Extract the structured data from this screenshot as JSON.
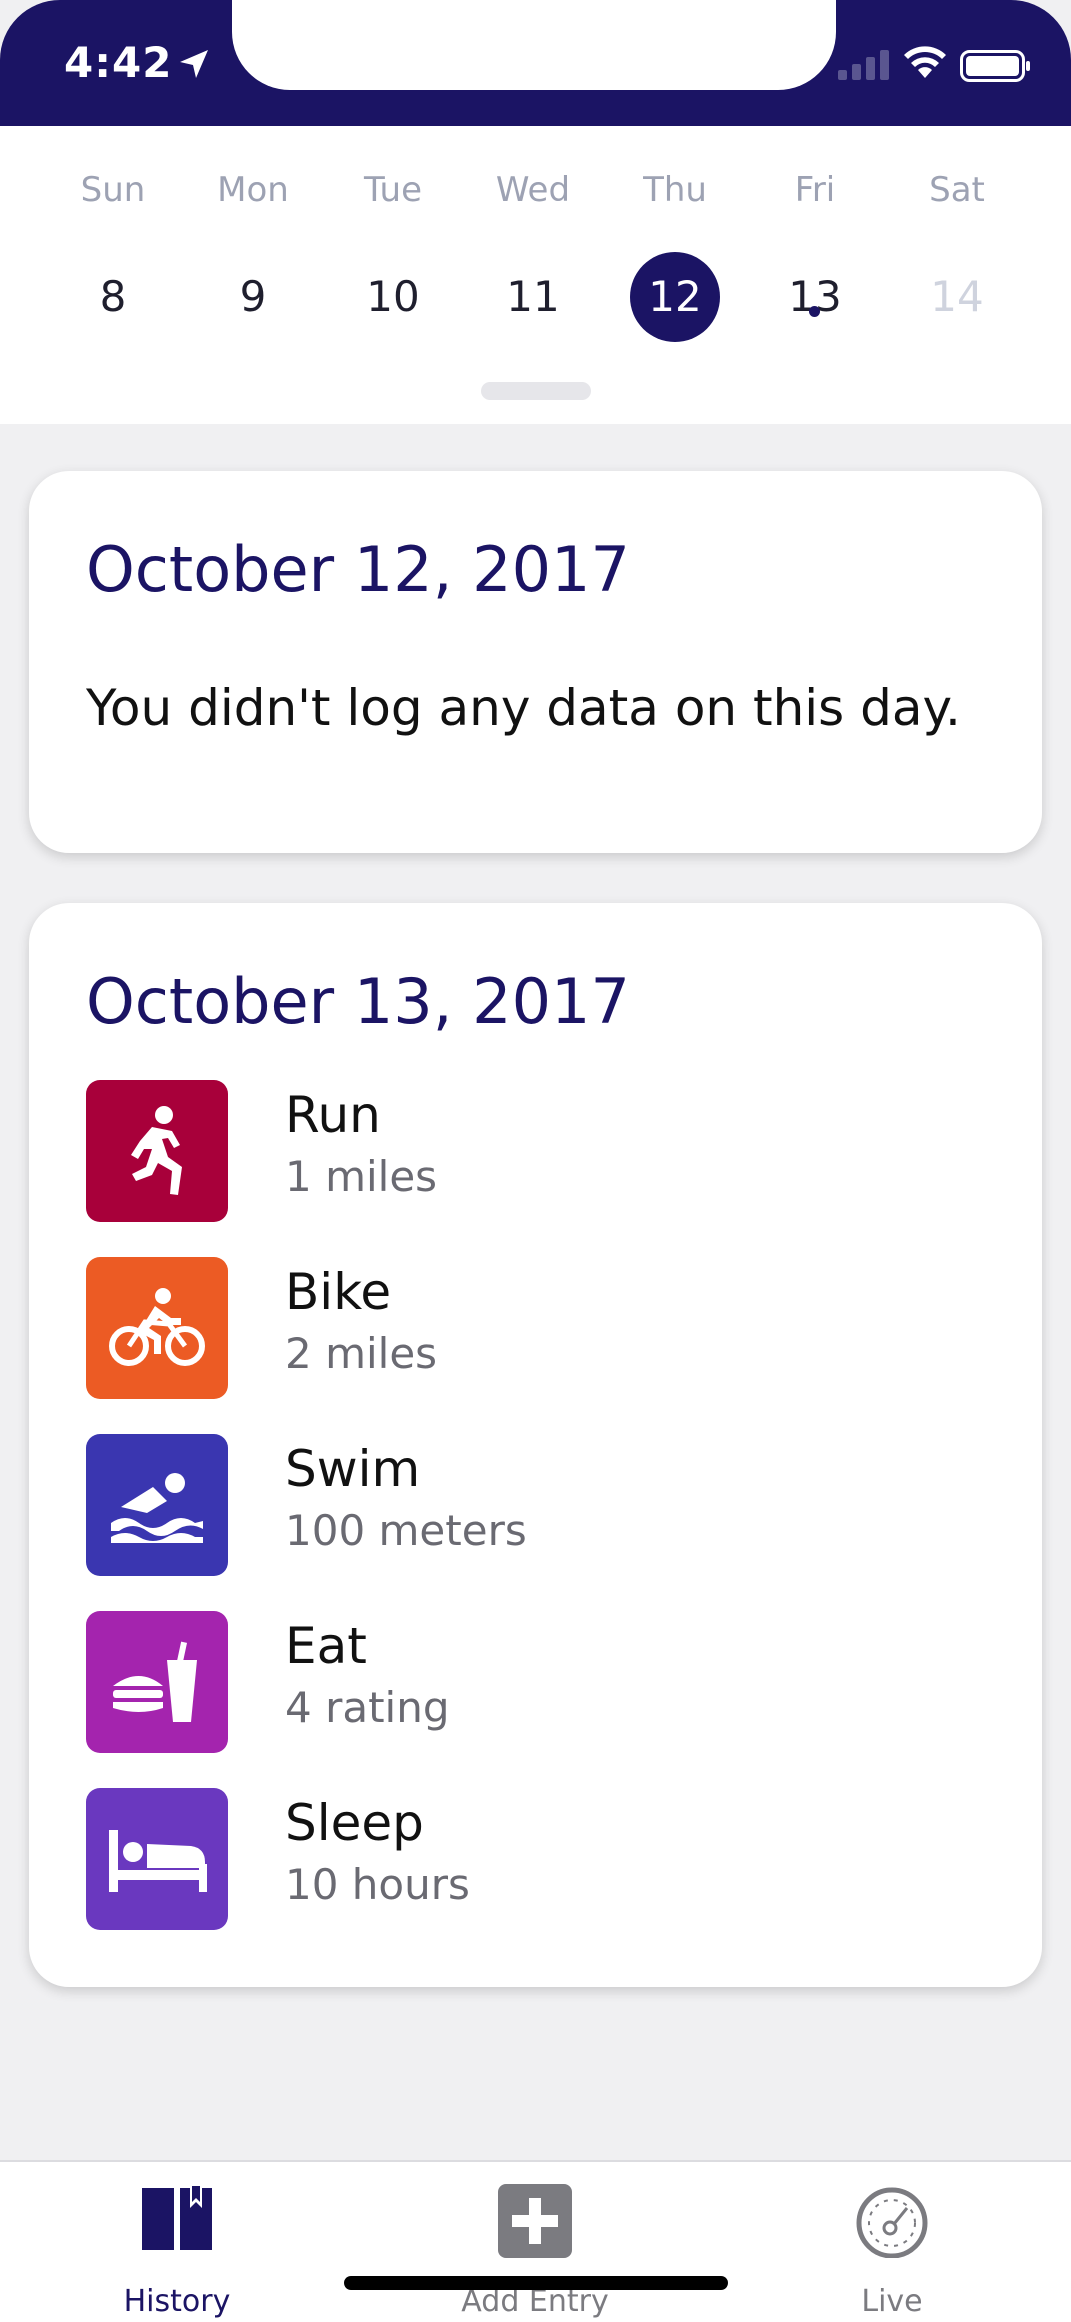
{
  "status_bar": {
    "time": "4:42"
  },
  "week": [
    {
      "name": "Sun",
      "num": "8",
      "state": "normal",
      "dot": false
    },
    {
      "name": "Mon",
      "num": "9",
      "state": "normal",
      "dot": false
    },
    {
      "name": "Tue",
      "num": "10",
      "state": "normal",
      "dot": false
    },
    {
      "name": "Wed",
      "num": "11",
      "state": "normal",
      "dot": false
    },
    {
      "name": "Thu",
      "num": "12",
      "state": "selected",
      "dot": false
    },
    {
      "name": "Fri",
      "num": "13",
      "state": "normal",
      "dot": true
    },
    {
      "name": "Sat",
      "num": "14",
      "state": "muted",
      "dot": false
    }
  ],
  "cards": [
    {
      "date": "October 12, 2017",
      "message": "You didn't log any data on this day."
    },
    {
      "date": "October 13, 2017",
      "activities": [
        {
          "name": "Run",
          "value": "1 miles",
          "icon": "run-icon",
          "color": "#a8003a"
        },
        {
          "name": "Bike",
          "value": "2 miles",
          "icon": "bike-icon",
          "color": "#ec5b24"
        },
        {
          "name": "Swim",
          "value": "100 meters",
          "icon": "swim-icon",
          "color": "#3a36b0"
        },
        {
          "name": "Eat",
          "value": "4 rating",
          "icon": "eat-icon",
          "color": "#a424ae"
        },
        {
          "name": "Sleep",
          "value": "10 hours",
          "icon": "sleep-icon",
          "color": "#6a38bf"
        }
      ]
    }
  ],
  "tabs": [
    {
      "label": "History",
      "icon": "book-icon",
      "active": true,
      "color": "#1b1464"
    },
    {
      "label": "Add Entry",
      "icon": "add-entry-icon",
      "active": false,
      "color": "#7b7b80"
    },
    {
      "label": "Live",
      "icon": "speedometer-icon",
      "active": false,
      "color": "#7b7b80"
    }
  ],
  "colors": {
    "accent": "#1b1464",
    "background": "#f0f0f2"
  }
}
